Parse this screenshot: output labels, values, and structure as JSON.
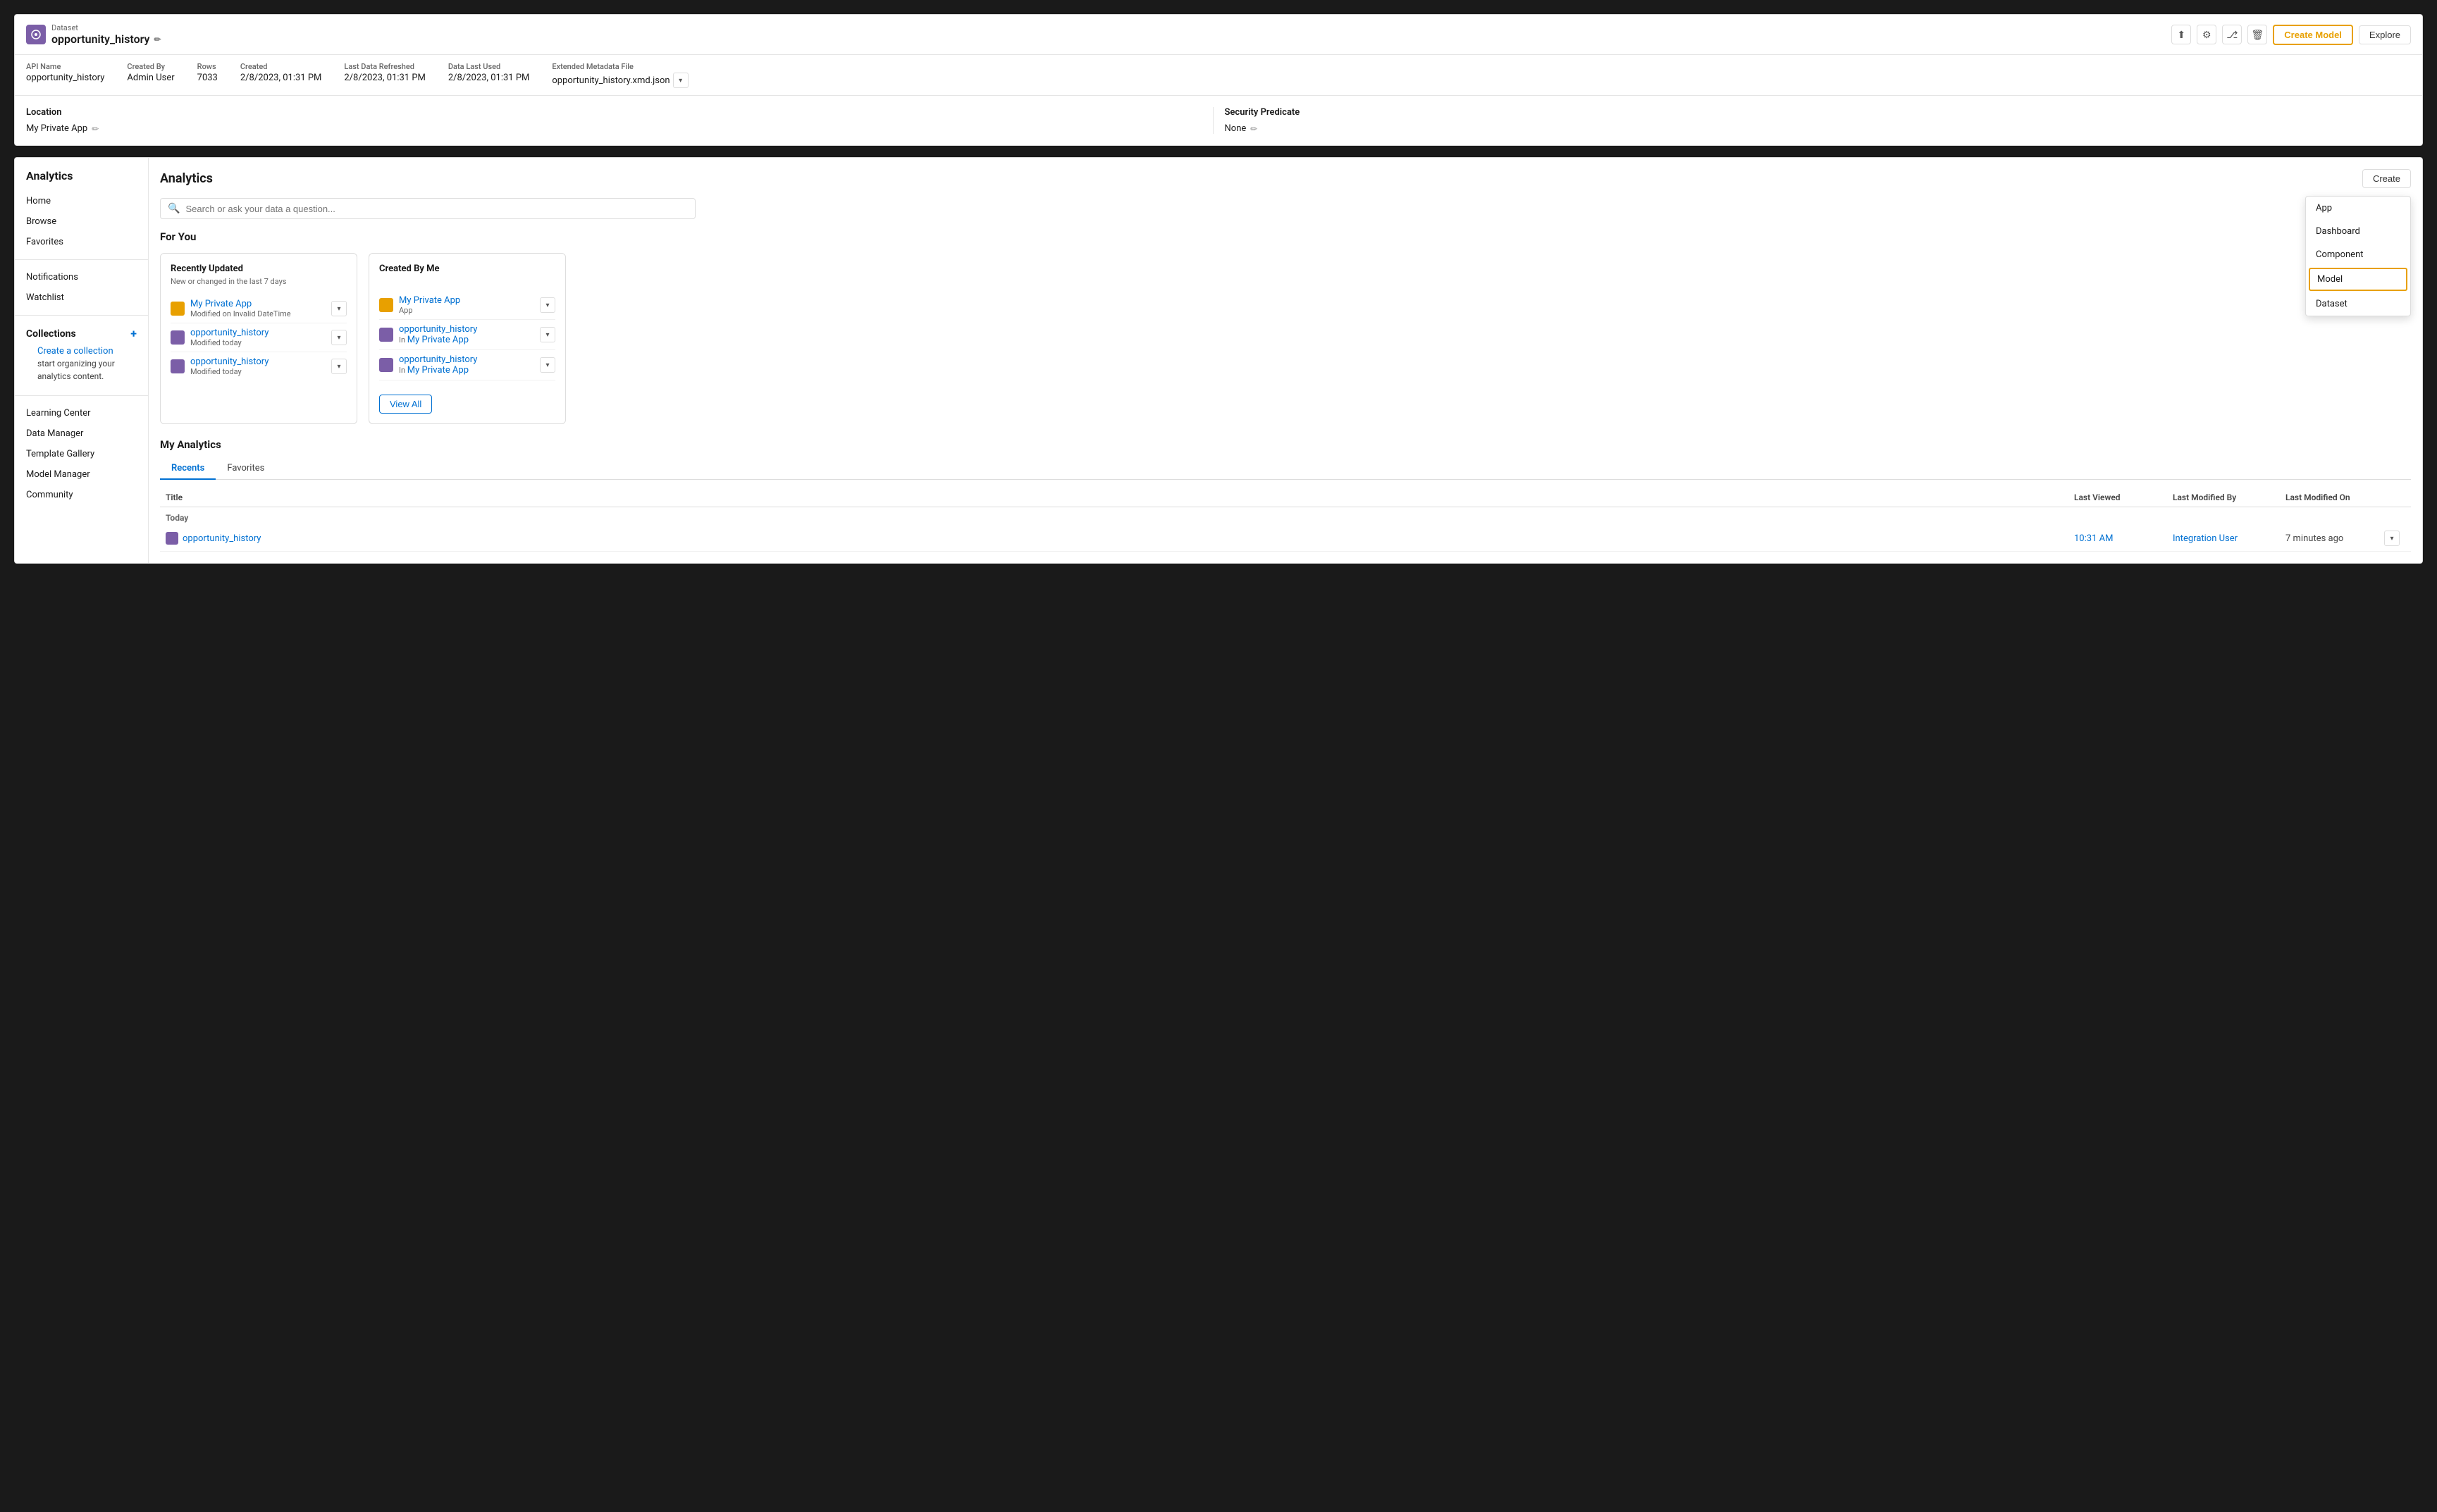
{
  "topPanel": {
    "datasetLabel": "Dataset",
    "datasetName": "opportunity_history",
    "meta": {
      "apiNameLabel": "API Name",
      "apiNameValue": "opportunity_history",
      "createdByLabel": "Created By",
      "createdByValue": "Admin User",
      "rowsLabel": "Rows",
      "rowsValue": "7033",
      "createdLabel": "Created",
      "createdValue": "2/8/2023, 01:31 PM",
      "lastRefreshedLabel": "Last Data Refreshed",
      "lastRefreshedValue": "2/8/2023, 01:31 PM",
      "dataLastUsedLabel": "Data Last Used",
      "dataLastUsedValue": "2/8/2023, 01:31 PM",
      "extMetaLabel": "Extended Metadata File",
      "extMetaValue": "opportunity_history.xmd.json"
    },
    "locationLabel": "Location",
    "locationValue": "My Private App",
    "securityPredicateLabel": "Security Predicate",
    "securityPredicateValue": "None",
    "actions": {
      "createModelLabel": "Create Model",
      "exploreLabel": "Explore"
    }
  },
  "sidebar": {
    "title": "Analytics",
    "navItems": [
      {
        "label": "Home"
      },
      {
        "label": "Browse"
      },
      {
        "label": "Favorites"
      }
    ],
    "notificationsLabel": "Notifications",
    "watchlistLabel": "Watchlist",
    "collectionsTitle": "Collections",
    "createCollectionText": "Create a collection to",
    "createCollectionText2": "start organizing your",
    "createCollectionText3": "analytics content.",
    "createCollectionLinkText": "Create a collection",
    "learningCenterLabel": "Learning Center",
    "dataManagerLabel": "Data Manager",
    "templateGalleryLabel": "Template Gallery",
    "modelManagerLabel": "Model Manager",
    "communityLabel": "Community"
  },
  "main": {
    "title": "Analytics",
    "createButtonLabel": "Create",
    "searchPlaceholder": "Search or ask your data a question...",
    "forYouTitle": "For You",
    "recentlyUpdatedTitle": "Recently Updated",
    "recentlyUpdatedSubtitle": "New or changed in the last 7 days",
    "recentlyUpdatedItems": [
      {
        "name": "My Private App",
        "type": "orange",
        "detail": "Modified on Invalid DateTime"
      },
      {
        "name": "opportunity_history",
        "type": "purple",
        "detail": "Modified today"
      },
      {
        "name": "opportunity_history",
        "type": "purple",
        "detail": "Modified today"
      }
    ],
    "createdByMeTitle": "Created By Me",
    "createdByMeItems": [
      {
        "name": "My Private App",
        "type": "orange",
        "detail": "App",
        "detailLink": false
      },
      {
        "name": "opportunity_history",
        "type": "purple",
        "detail": "In",
        "detailLinkText": "My Private App"
      },
      {
        "name": "opportunity_history",
        "type": "purple",
        "detail": "In",
        "detailLinkText": "My Private App"
      }
    ],
    "viewAllLabel": "View All",
    "myAnalyticsTitle": "My Analytics",
    "tabs": [
      {
        "label": "Recents",
        "active": true
      },
      {
        "label": "Favorites",
        "active": false
      }
    ],
    "tableHeaders": {
      "title": "Title",
      "lastViewed": "Last Viewed",
      "lastModifiedBy": "Last Modified By",
      "lastModifiedOn": "Last Modified On"
    },
    "tableGroupToday": "Today",
    "tableRows": [
      {
        "name": "opportunity_history",
        "iconType": "purple",
        "lastViewed": "10:31 AM",
        "lastModifiedBy": "Integration User",
        "lastModifiedOn": "7 minutes ago"
      }
    ],
    "dropdown": {
      "items": [
        {
          "label": "App",
          "highlighted": false
        },
        {
          "label": "Dashboard",
          "highlighted": false
        },
        {
          "label": "Component",
          "highlighted": false
        },
        {
          "label": "Model",
          "highlighted": true
        },
        {
          "label": "Dataset",
          "highlighted": false
        }
      ]
    }
  },
  "icons": {
    "pencil": "✏",
    "upload": "⬆",
    "gear": "⚙",
    "branch": "⎇",
    "trash": "🗑",
    "chevronDown": "▾",
    "search": "🔍",
    "plus": "+"
  }
}
